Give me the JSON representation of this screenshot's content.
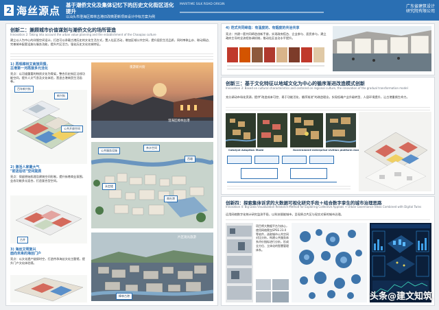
{
  "header": {
    "section_number": "2",
    "title": "海丝源点",
    "subtitle_main": "基于潮侨文化及集体记忆下的历史文化街区活化提升",
    "subtitle_sub": "以汕头市澄海区樟林古港旧改微更新项目设计中标方案为例",
    "en_title": "MARITIME SILK ROAD ORIGIN",
    "logo_text": "广东省建筑设计研究院有限公司"
  },
  "left": {
    "title": "创新二：兼顾城市价值谋划与潮侨文化的场所营造",
    "en_sub": "Innovation 2: Taking into account the urban value planning and the establishment of the Chaoqiao culture",
    "paragraph": "建立以人为中心的详细空间设计，打造可以承载古港历史的文化生活方式，置入社区活动，增加区域公共空间，提升居民生活品质，同时串联山水、联动周边、完善城市配套设施与服务功能，提升片区活力，强化历史文化名城特征。",
    "points": [
      {
        "heading": "1) 再现樟林文商旅风情，\n古港第一河再接多元活化",
        "text": "亮点：以河道重要的物质文化为骨架，整合历史街区沿线功能空间，提升人文气息及文化体验，营造古港商贸生活画卷。"
      },
      {
        "heading": "2) 激活人家最大气\n\"前店后坊\"空间提质",
        "text": "亮点：保留原始肌理及建筑空间形制，提升街巷商业氛围，业态功能多元混合，打造复合型空间。"
      },
      {
        "heading": "3) 海丝文明复兴\n面向未来的海丝门户",
        "text": "亮点：以文化遗产链接时空，打造传承海丝文化主题馆，提升门户文化体验感。"
      }
    ],
    "tags": [
      "百年新兴街",
      "新兴街",
      "公共开放空间",
      "古井",
      "公共服务设施",
      "亲水空间",
      "西塘",
      "永定楼",
      "南社港",
      "樟林古港",
      "城市主要道路"
    ],
    "photo_captions": [
      "夜游新兴街",
      "澄海区樟林古港",
      "片区观光旅游"
    ]
  },
  "right_top": {
    "title": "4) 范式共同缔造：有温度的、有烟度的共治共享",
    "text": "亮点：共建一套共同缔造创新手册，实现政府搭台、企业参与、居民参与，建立政府主导的全流程协调机制，推动社区自治水平提升。"
  },
  "right_mid": {
    "title": "创新三：基于文化特征以地域文化为中心的循序渐进改造模式创新",
    "en_sub": "Innovation 3: Based on cultural characteristics and centered on regional culture, the innovation of the gradual transformation model",
    "paragraph": "充分调动市场化资源，提供\"改造成本可控、易于功能活化、循序渐进\"的改造理念，实现低端产业升级转型、人居环境提升，让古港重焕生命力。",
    "labels": [
      "Catalyst Adaption Mode",
      "Government-enterprise-civilian platform mode"
    ]
  },
  "right_bottom": {
    "title": "创新四：探索集体诉求的大数据可视化研究手段＋结合数字孪生的城市治理思路",
    "en_sub": "Innovation 4: Big Data Visualization Research Method for Exploring Collective Appeals + Urban Governance Ideas Combined with Digital Twins",
    "paragraph": "运用网络数字化统计研究监测手段，以科技赋能城市，呈现原点片区与现实对接的城市治理。",
    "text_block": "项目将大数据平台为核心，使用网络爬虫SPSS 23.0等软件，选取城市公共空间对比分析，构建公共服务体系评价指标进行分析，形成全方位、立体化的智慧管理体系。"
  },
  "watermark": "头条@建文知筑",
  "colors": {
    "accent": "#2a6fb3",
    "title": "#1f3b57",
    "text": "#333333",
    "panel": "#ffffff",
    "background": "#eef0f2"
  }
}
